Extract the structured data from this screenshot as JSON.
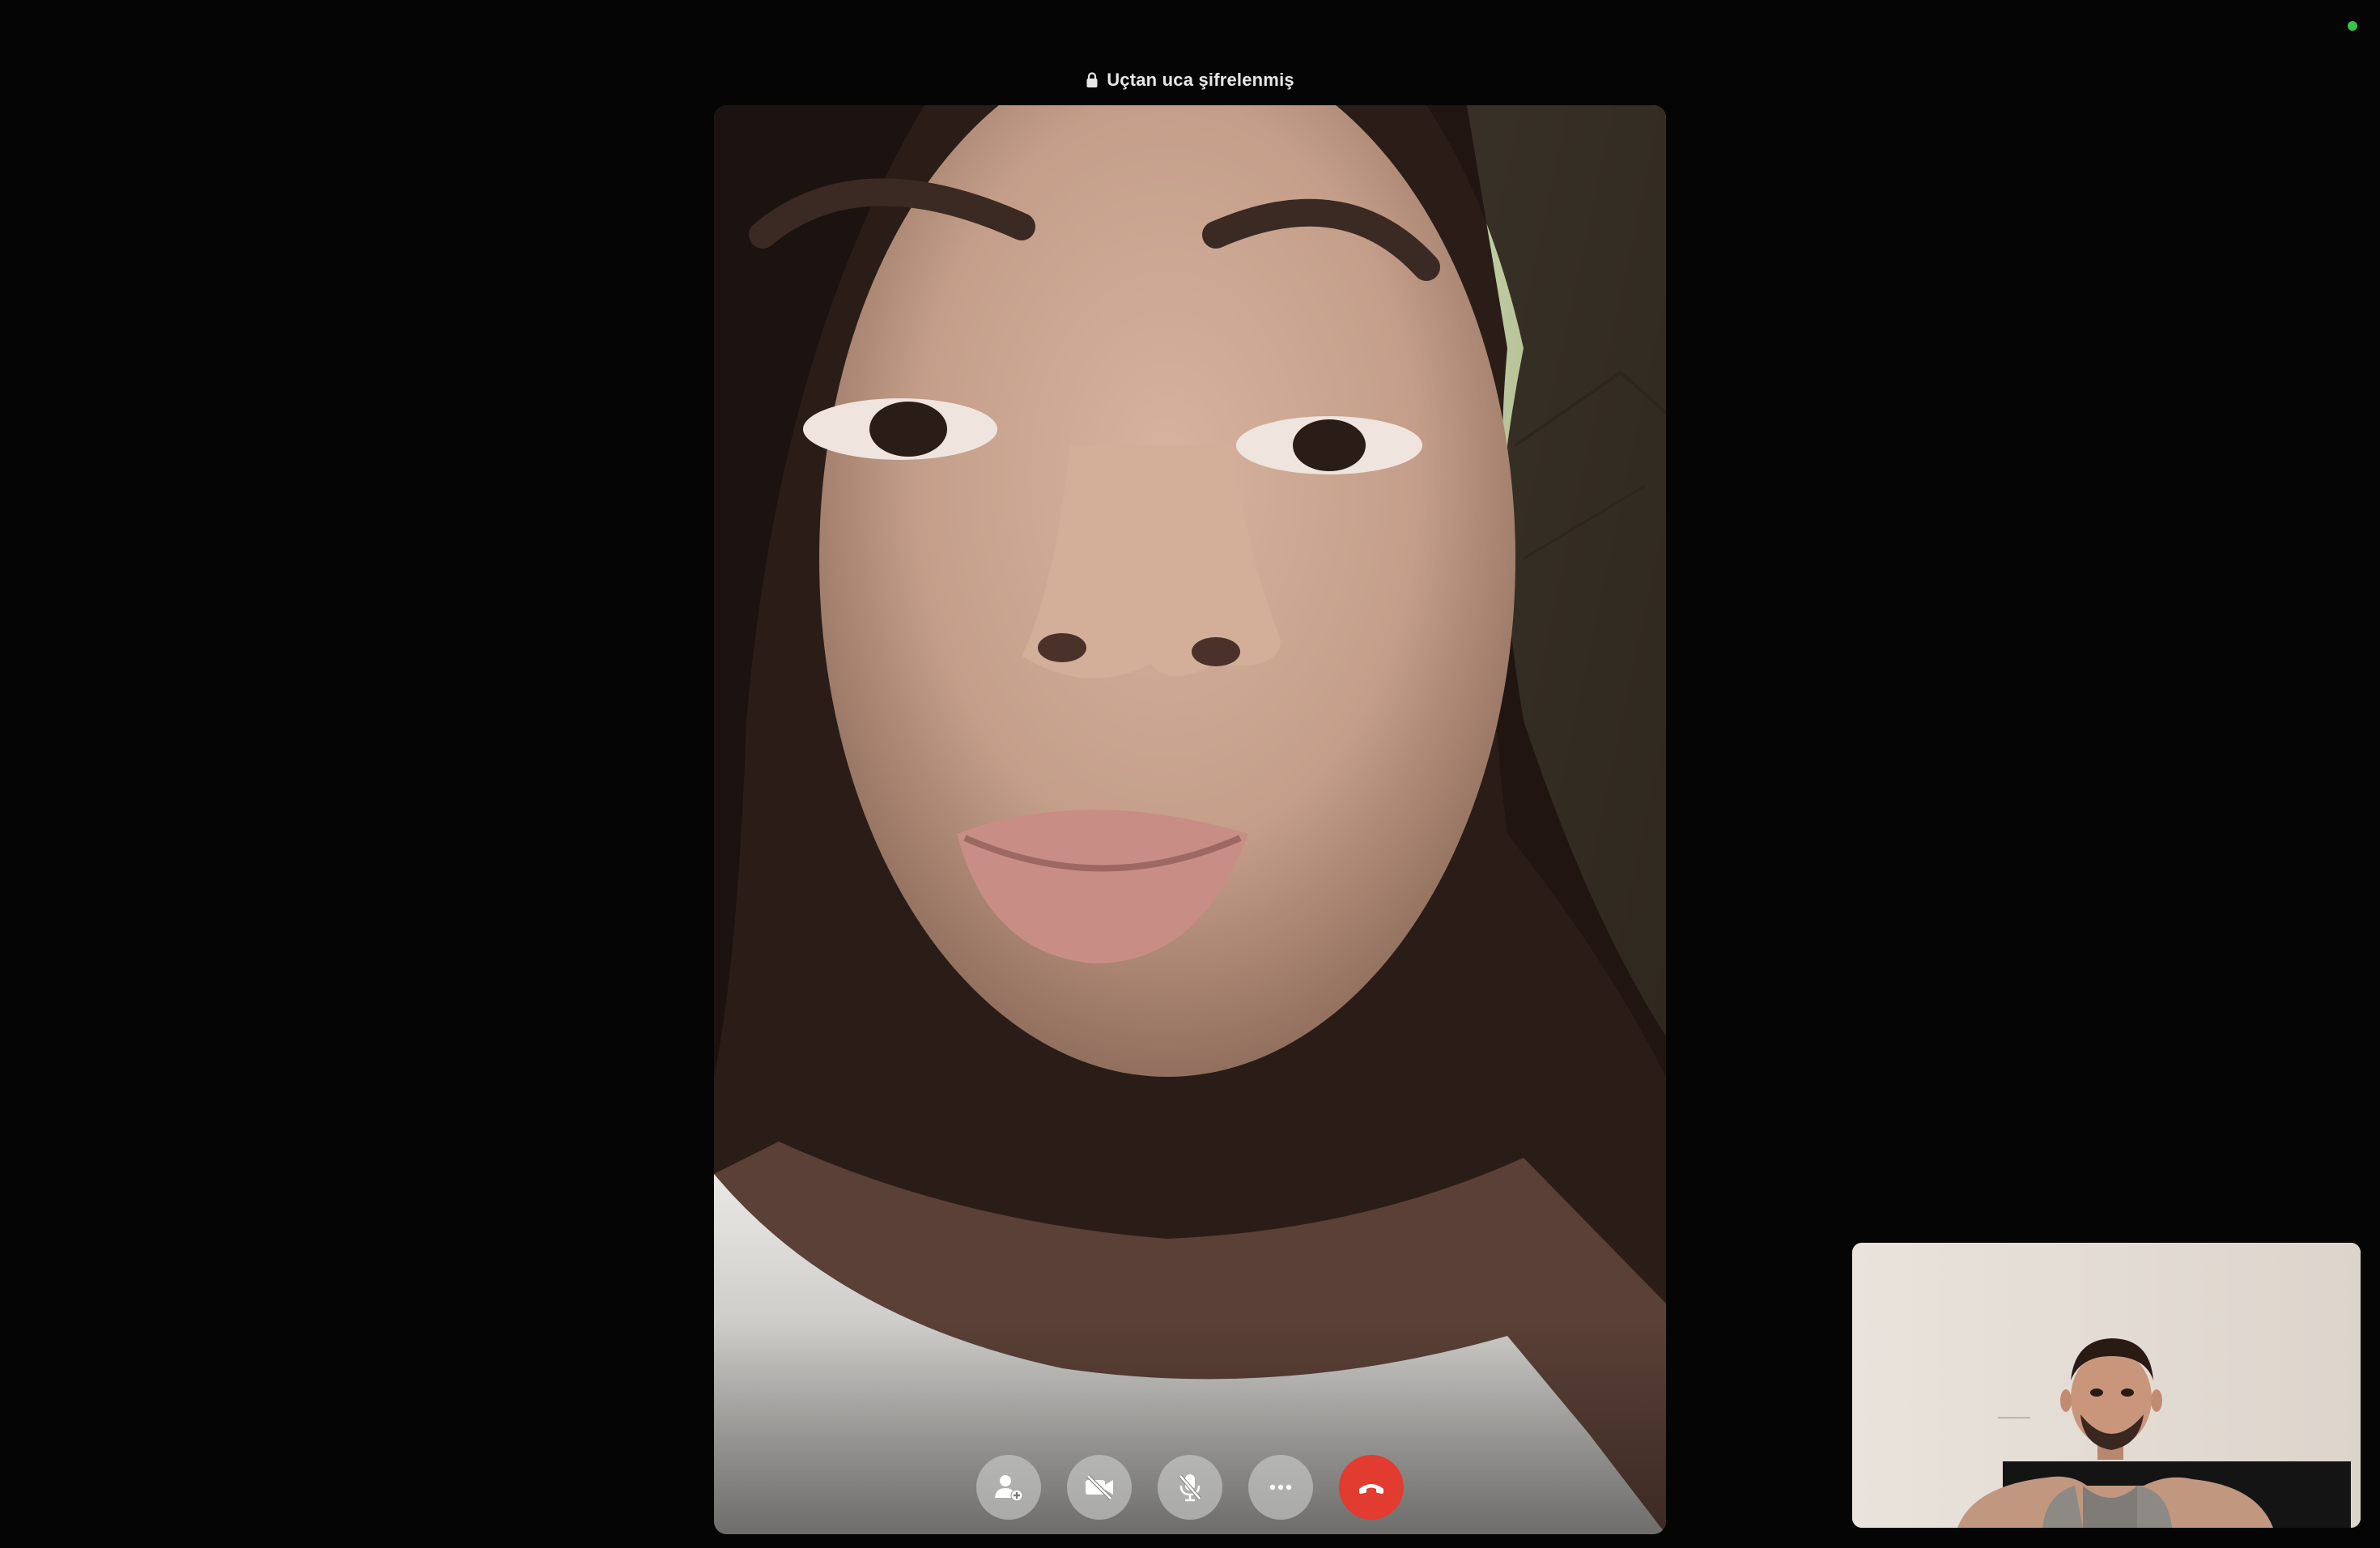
{
  "call": {
    "encryption_label": "Uçtan uca şifrelenmiş",
    "lock_icon": "lock-icon",
    "status_indicator_color": "#37c34a"
  },
  "remote_participant": {
    "video_state": "active"
  },
  "self_view": {
    "video_state": "active"
  },
  "controls": [
    {
      "name": "add-person-button",
      "icon": "add-person-icon"
    },
    {
      "name": "camera-toggle-button",
      "icon": "video-off-icon"
    },
    {
      "name": "mute-button",
      "icon": "mic-off-icon"
    },
    {
      "name": "more-options-button",
      "icon": "ellipsis-icon"
    },
    {
      "name": "end-call-button",
      "icon": "hang-up-icon",
      "color": "#e23b2f"
    }
  ]
}
